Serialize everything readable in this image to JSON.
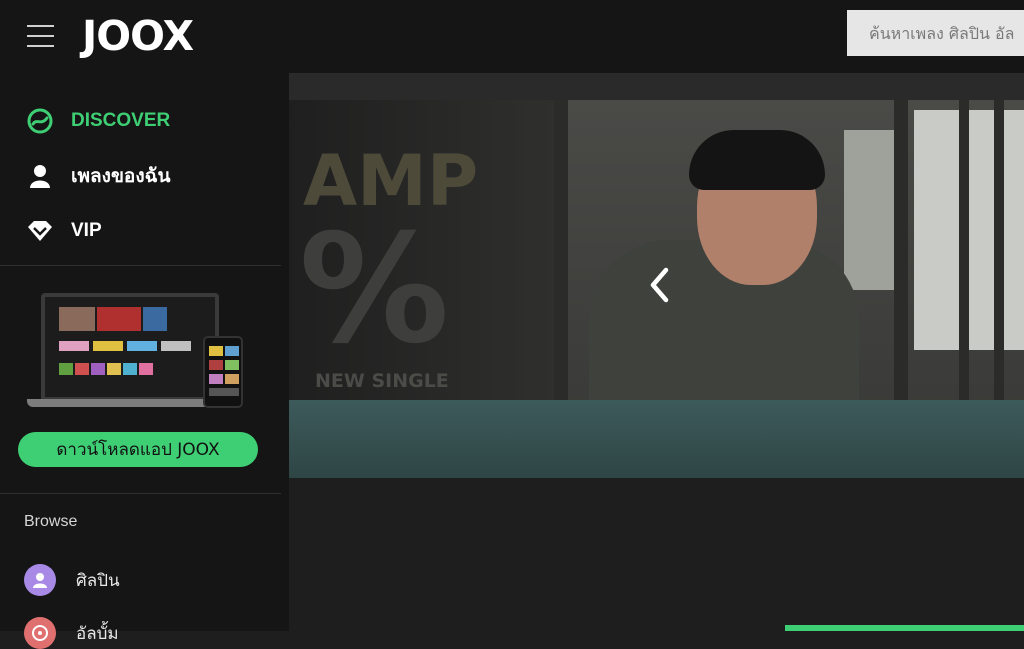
{
  "header": {
    "logo_text": "JOOX",
    "menu_icon": "hamburger-menu-icon",
    "search_placeholder": "ค้นหาเพลง ศิลปิน อัล"
  },
  "sidebar": {
    "nav": [
      {
        "label": "DISCOVER",
        "icon": "discover-icon",
        "active": true,
        "color": "#3ecf74"
      },
      {
        "label": "เพลงของฉัน",
        "icon": "user-icon",
        "active": false
      },
      {
        "label": "VIP",
        "icon": "diamond-icon",
        "active": false
      }
    ],
    "download_button": "ดาวน์โหลดแอป JOOX",
    "browse_title": "Browse",
    "browse_items": [
      {
        "label": "ศิลปิน",
        "icon": "artist-icon",
        "color": "#9b7be0"
      },
      {
        "label": "อัลบั้ม",
        "icon": "album-icon",
        "color": "#e06b6b"
      }
    ]
  },
  "banner": {
    "text_line1": "AMP",
    "text_line2": "%",
    "text_line3": "NEW SINGLE",
    "prev_arrow": "chevron-left-icon"
  },
  "colors": {
    "accent": "#3ecf74",
    "background": "#1e1e1e",
    "sidebar": "#151515"
  }
}
